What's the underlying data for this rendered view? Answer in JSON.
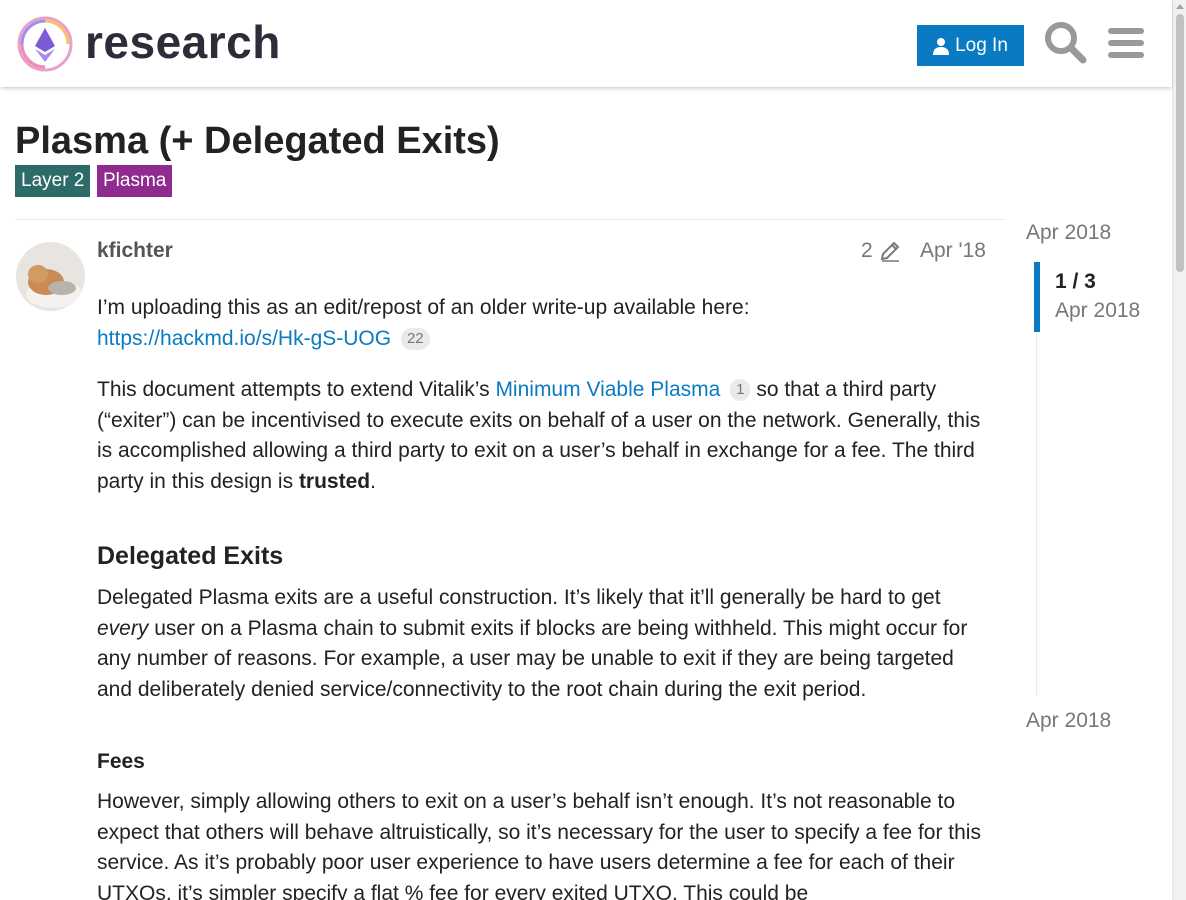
{
  "header": {
    "logo_text": "research",
    "login_label": "Log In"
  },
  "topic": {
    "title": "Plasma (+ Delegated Exits)",
    "tags": [
      {
        "label": "Layer 2",
        "color": "#2d6b69"
      },
      {
        "label": "Plasma",
        "color": "#8f2a8f"
      }
    ]
  },
  "post": {
    "username": "kfichter",
    "edit_count": "2",
    "date": "Apr '18",
    "intro": "I’m uploading this as an edit/repost of an older write-up available here:",
    "intro_link": "https://hackmd.io/s/Hk-gS-UOG",
    "intro_link_clicks": "22",
    "p2_before": "This document attempts to extend Vitalik’s ",
    "p2_link": "Minimum Viable Plasma",
    "p2_link_clicks": "1",
    "p2_after": " so that a third party (“exiter”) can be incentivised to execute exits on behalf of a user on the network. Generally, this is accomplished allowing a third party to exit on a user’s behalf in exchange for a fee. The third party in this design is ",
    "p2_bold": "trusted",
    "p2_end": ".",
    "h_delegated": "Delegated Exits",
    "p3_before": "Delegated Plasma exits are a useful construction. It’s likely that it’ll generally be hard to get ",
    "p3_em": "every",
    "p3_after": " user on a Plasma chain to submit exits if blocks are being withheld. This might occur for any number of reasons. For example, a user may be unable to exit if they are being targeted and deliberately denied service/connectivity to the root chain during the exit period.",
    "h_fees": "Fees",
    "p4": "However, simply allowing others to exit on a user’s behalf isn’t enough. It’s not reasonable to expect that others will behave altruistically, so it’s necessary for the user to specify a fee for this service. As it’s probably poor user experience to have users determine a fee for each of their UTXOs, it’s simpler specify a flat % fee for every exited UTXO. This could be"
  },
  "timeline": {
    "top_date": "Apr 2018",
    "position": "1 / 3",
    "position_date": "Apr 2018",
    "bottom_date": "Apr 2018"
  },
  "colors": {
    "accent": "#0a7ac2"
  }
}
